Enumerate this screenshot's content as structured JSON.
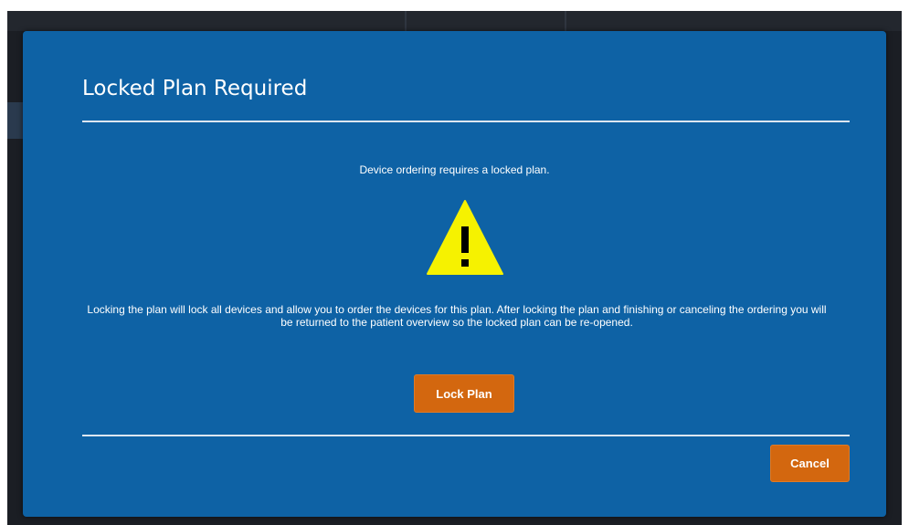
{
  "modal": {
    "title": "Locked Plan Required",
    "intro": "Device ordering requires a locked plan.",
    "warning_icon": "warning-triangle-icon",
    "body": "Locking the plan will lock all devices and allow you to order the devices for this plan. After locking the plan and finishing or canceling the ordering you will be returned to the patient overview so the locked plan can be re-opened.",
    "lock_button": "Lock Plan",
    "cancel_button": "Cancel"
  },
  "colors": {
    "modal_background": "#0e62a5",
    "button_background": "#d3670f",
    "warning_fill": "#f6f200",
    "backdrop": "#1b1e24"
  }
}
